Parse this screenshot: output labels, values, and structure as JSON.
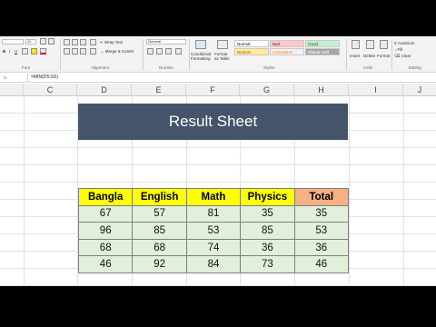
{
  "ribbon": {
    "font_size": "11",
    "wrap_text": "Wrap Text",
    "merge_center": "Merge & Center",
    "number_format": "General",
    "conditional_formatting": "Conditional Formatting",
    "format_as_table": "Format as Table",
    "styles": {
      "normal": "Normal",
      "bad": "Bad",
      "good": "Good",
      "neutral": "Neutral",
      "calculation": "Calculation",
      "check_cell": "Check Cell"
    },
    "insert": "Insert",
    "delete": "Delete",
    "format": "Format",
    "autosum": "AutoSum",
    "fill": "Fill",
    "clear": "Clear",
    "group_labels": {
      "font": "Font",
      "alignment": "Alignment",
      "number": "Number",
      "styles": "Styles",
      "cells": "Cells",
      "editing": "Editing"
    }
  },
  "formula_bar": {
    "formula": "=MIN(D5:G5)"
  },
  "columns": [
    "C",
    "D",
    "E",
    "F",
    "G",
    "H",
    "I",
    "J"
  ],
  "result_sheet": {
    "title": "Result Sheet",
    "headers": [
      "Bangla",
      "English",
      "Math",
      "Physics",
      "Total"
    ],
    "rows": [
      [
        "67",
        "57",
        "81",
        "35",
        "35"
      ],
      [
        "96",
        "85",
        "53",
        "85",
        "53"
      ],
      [
        "68",
        "68",
        "74",
        "36",
        "36"
      ],
      [
        "46",
        "92",
        "84",
        "73",
        "46"
      ]
    ]
  },
  "colors": {
    "title_bg": "#44546a",
    "header_bg": "#ffff00",
    "total_header_bg": "#f4b183",
    "cell_bg": "#e2efda"
  }
}
